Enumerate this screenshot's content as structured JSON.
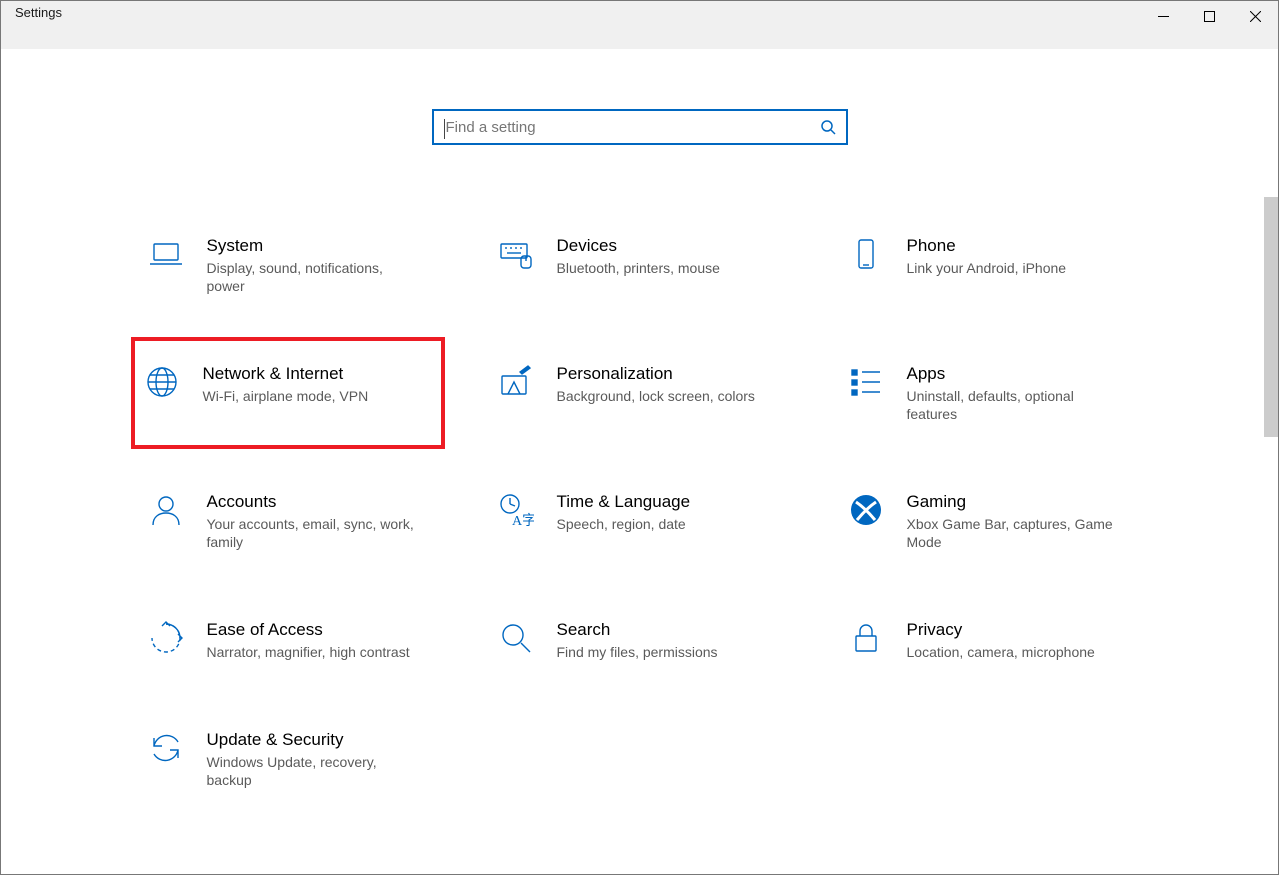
{
  "window": {
    "title": "Settings"
  },
  "search": {
    "placeholder": "Find a setting"
  },
  "tiles": {
    "system": {
      "title": "System",
      "sub": "Display, sound, notifications, power"
    },
    "devices": {
      "title": "Devices",
      "sub": "Bluetooth, printers, mouse"
    },
    "phone": {
      "title": "Phone",
      "sub": "Link your Android, iPhone"
    },
    "network": {
      "title": "Network & Internet",
      "sub": "Wi-Fi, airplane mode, VPN"
    },
    "personalization": {
      "title": "Personalization",
      "sub": "Background, lock screen, colors"
    },
    "apps": {
      "title": "Apps",
      "sub": "Uninstall, defaults, optional features"
    },
    "accounts": {
      "title": "Accounts",
      "sub": "Your accounts, email, sync, work, family"
    },
    "time": {
      "title": "Time & Language",
      "sub": "Speech, region, date"
    },
    "gaming": {
      "title": "Gaming",
      "sub": "Xbox Game Bar, captures, Game Mode"
    },
    "ease": {
      "title": "Ease of Access",
      "sub": "Narrator, magnifier, high contrast"
    },
    "searchcat": {
      "title": "Search",
      "sub": "Find my files, permissions"
    },
    "privacy": {
      "title": "Privacy",
      "sub": "Location, camera, microphone"
    },
    "update": {
      "title": "Update & Security",
      "sub": "Windows Update, recovery, backup"
    }
  }
}
